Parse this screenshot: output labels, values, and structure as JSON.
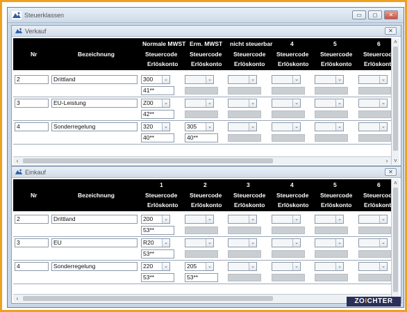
{
  "main_window": {
    "title": "Steuerklassen"
  },
  "window_buttons": {
    "minimize": "▭",
    "maximize": "◻",
    "close": "✕"
  },
  "verkauf": {
    "title": "Verkauf",
    "close": "✕",
    "headers": {
      "nr": "Nr",
      "bezeichnung": "Bezeichnung",
      "cols": [
        {
          "top": "Normale MWST",
          "code": "Steuercode",
          "acct": "Erlöskonto"
        },
        {
          "top": "Erm. MWST",
          "code": "Steuercode",
          "acct": "Erlöskonto"
        },
        {
          "top": "nicht steuerbar",
          "code": "Steuercode",
          "acct": "Erlöskonto"
        },
        {
          "top": "4",
          "code": "Steuercode",
          "acct": "Erlöskonto"
        },
        {
          "top": "5",
          "code": "Steuercode",
          "acct": "Erlöskonto"
        },
        {
          "top": "6",
          "code": "Steuercode",
          "acct": "Erlöskonto"
        }
      ]
    },
    "rows": [
      {
        "nr": "2",
        "bez": "Drittland",
        "c1": "300",
        "k1": "41**",
        "c2": "",
        "k2": ""
      },
      {
        "nr": "3",
        "bez": "EU-Leistung",
        "c1": "Z00",
        "k1": "42**",
        "c2": "",
        "k2": ""
      },
      {
        "nr": "4",
        "bez": "Sonderregelung",
        "c1": "320",
        "k1": "40**",
        "c2": "305",
        "k2": "40**"
      }
    ]
  },
  "einkauf": {
    "title": "Einkauf",
    "close": "✕",
    "headers": {
      "nr": "Nr",
      "bezeichnung": "Bezeichnung",
      "cols": [
        {
          "top": "1",
          "code": "Steuercode",
          "acct": "Erlöskonto"
        },
        {
          "top": "2",
          "code": "Steuercode",
          "acct": "Erlöskonto"
        },
        {
          "top": "3",
          "code": "Steuercode",
          "acct": "Erlöskonto"
        },
        {
          "top": "4",
          "code": "Steuercode",
          "acct": "Erlöskonto"
        },
        {
          "top": "5",
          "code": "Steuercode",
          "acct": "Erlöskonto"
        },
        {
          "top": "6",
          "code": "Steuercode",
          "acct": "Erlöskonto"
        }
      ]
    },
    "rows": [
      {
        "nr": "2",
        "bez": "Drittland",
        "c1": "200",
        "k1": "53**",
        "c2": "",
        "k2": ""
      },
      {
        "nr": "3",
        "bez": "EU",
        "c1": "R20",
        "k1": "53**",
        "c2": "",
        "k2": ""
      },
      {
        "nr": "4",
        "bez": "Sonderregelung",
        "c1": "220",
        "k1": "53**",
        "c2": "205",
        "k2": "53**"
      }
    ]
  },
  "logo": {
    "part1": "ZO",
    "accent": "I",
    "part2": "CHTER"
  },
  "icons": {
    "dropdown": "⌄",
    "scroll_left": "‹",
    "scroll_right": "›",
    "scroll_up": "˄",
    "scroll_down": "˅"
  },
  "colors": {
    "frame": "#f0a020",
    "header_bg": "#000000",
    "window_bg": "#c8d8e8"
  }
}
